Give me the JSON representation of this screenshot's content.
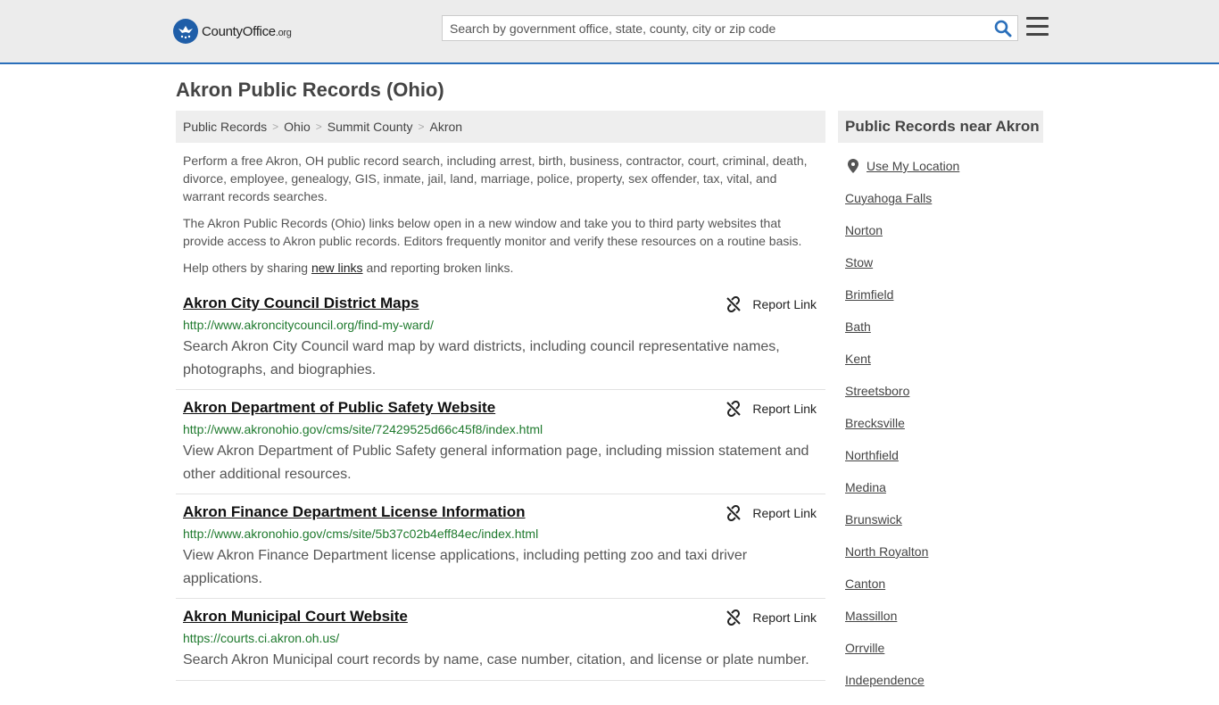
{
  "header": {
    "logo_main": "CountyOffice",
    "logo_suffix": ".org",
    "search_placeholder": "Search by government office, state, county, city or zip code"
  },
  "page_title": "Akron Public Records (Ohio)",
  "breadcrumb": [
    "Public Records",
    "Ohio",
    "Summit County",
    "Akron"
  ],
  "intro": {
    "p1": "Perform a free Akron, OH public record search, including arrest, birth, business, contractor, court, criminal, death, divorce, employee, genealogy, GIS, inmate, jail, land, marriage, police, property, sex offender, tax, vital, and warrant records searches.",
    "p2": "The Akron Public Records (Ohio) links below open in a new window and take you to third party websites that provide access to Akron public records. Editors frequently monitor and verify these resources on a routine basis.",
    "p3_before": "Help others by sharing ",
    "p3_link": "new links",
    "p3_after": " and reporting broken links."
  },
  "report_label": "Report Link",
  "entries": [
    {
      "title": "Akron City Council District Maps",
      "url": "http://www.akroncitycouncil.org/find-my-ward/",
      "desc": "Search Akron City Council ward map by ward districts, including council representative names, photographs, and biographies."
    },
    {
      "title": "Akron Department of Public Safety Website",
      "url": "http://www.akronohio.gov/cms/site/72429525d66c45f8/index.html",
      "desc": "View Akron Department of Public Safety general information page, including mission statement and other additional resources."
    },
    {
      "title": "Akron Finance Department License Information",
      "url": "http://www.akronohio.gov/cms/site/5b37c02b4eff84ec/index.html",
      "desc": "View Akron Finance Department license applications, including petting zoo and taxi driver applications."
    },
    {
      "title": "Akron Municipal Court Website",
      "url": "https://courts.ci.akron.oh.us/",
      "desc": "Search Akron Municipal court records by name, case number, citation, and license or plate number."
    }
  ],
  "sidebar": {
    "heading": "Public Records near Akron",
    "use_location": "Use My Location",
    "cities": [
      "Cuyahoga Falls",
      "Norton",
      "Stow",
      "Brimfield",
      "Bath",
      "Kent",
      "Streetsboro",
      "Brecksville",
      "Northfield",
      "Medina",
      "Brunswick",
      "North Royalton",
      "Canton",
      "Massillon",
      "Orrville",
      "Independence"
    ]
  },
  "colors": {
    "accent": "#2a6fba",
    "url_green": "#1f7a2e"
  }
}
